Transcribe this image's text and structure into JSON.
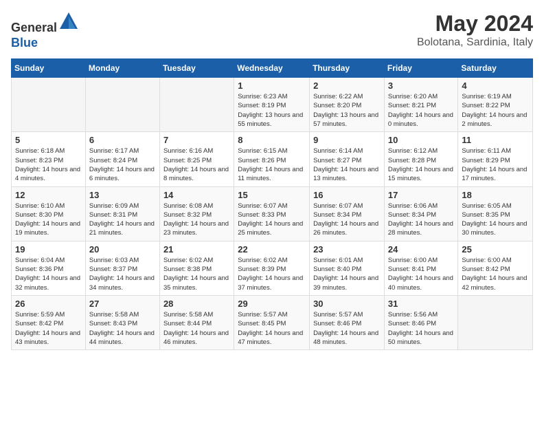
{
  "header": {
    "logo_line1": "General",
    "logo_line2": "Blue",
    "month_title": "May 2024",
    "location": "Bolotana, Sardinia, Italy"
  },
  "days_of_week": [
    "Sunday",
    "Monday",
    "Tuesday",
    "Wednesday",
    "Thursday",
    "Friday",
    "Saturday"
  ],
  "weeks": [
    [
      {
        "day": "",
        "sunrise": "",
        "sunset": "",
        "daylight": ""
      },
      {
        "day": "",
        "sunrise": "",
        "sunset": "",
        "daylight": ""
      },
      {
        "day": "",
        "sunrise": "",
        "sunset": "",
        "daylight": ""
      },
      {
        "day": "1",
        "sunrise": "Sunrise: 6:23 AM",
        "sunset": "Sunset: 8:19 PM",
        "daylight": "Daylight: 13 hours and 55 minutes."
      },
      {
        "day": "2",
        "sunrise": "Sunrise: 6:22 AM",
        "sunset": "Sunset: 8:20 PM",
        "daylight": "Daylight: 13 hours and 57 minutes."
      },
      {
        "day": "3",
        "sunrise": "Sunrise: 6:20 AM",
        "sunset": "Sunset: 8:21 PM",
        "daylight": "Daylight: 14 hours and 0 minutes."
      },
      {
        "day": "4",
        "sunrise": "Sunrise: 6:19 AM",
        "sunset": "Sunset: 8:22 PM",
        "daylight": "Daylight: 14 hours and 2 minutes."
      }
    ],
    [
      {
        "day": "5",
        "sunrise": "Sunrise: 6:18 AM",
        "sunset": "Sunset: 8:23 PM",
        "daylight": "Daylight: 14 hours and 4 minutes."
      },
      {
        "day": "6",
        "sunrise": "Sunrise: 6:17 AM",
        "sunset": "Sunset: 8:24 PM",
        "daylight": "Daylight: 14 hours and 6 minutes."
      },
      {
        "day": "7",
        "sunrise": "Sunrise: 6:16 AM",
        "sunset": "Sunset: 8:25 PM",
        "daylight": "Daylight: 14 hours and 8 minutes."
      },
      {
        "day": "8",
        "sunrise": "Sunrise: 6:15 AM",
        "sunset": "Sunset: 8:26 PM",
        "daylight": "Daylight: 14 hours and 11 minutes."
      },
      {
        "day": "9",
        "sunrise": "Sunrise: 6:14 AM",
        "sunset": "Sunset: 8:27 PM",
        "daylight": "Daylight: 14 hours and 13 minutes."
      },
      {
        "day": "10",
        "sunrise": "Sunrise: 6:12 AM",
        "sunset": "Sunset: 8:28 PM",
        "daylight": "Daylight: 14 hours and 15 minutes."
      },
      {
        "day": "11",
        "sunrise": "Sunrise: 6:11 AM",
        "sunset": "Sunset: 8:29 PM",
        "daylight": "Daylight: 14 hours and 17 minutes."
      }
    ],
    [
      {
        "day": "12",
        "sunrise": "Sunrise: 6:10 AM",
        "sunset": "Sunset: 8:30 PM",
        "daylight": "Daylight: 14 hours and 19 minutes."
      },
      {
        "day": "13",
        "sunrise": "Sunrise: 6:09 AM",
        "sunset": "Sunset: 8:31 PM",
        "daylight": "Daylight: 14 hours and 21 minutes."
      },
      {
        "day": "14",
        "sunrise": "Sunrise: 6:08 AM",
        "sunset": "Sunset: 8:32 PM",
        "daylight": "Daylight: 14 hours and 23 minutes."
      },
      {
        "day": "15",
        "sunrise": "Sunrise: 6:07 AM",
        "sunset": "Sunset: 8:33 PM",
        "daylight": "Daylight: 14 hours and 25 minutes."
      },
      {
        "day": "16",
        "sunrise": "Sunrise: 6:07 AM",
        "sunset": "Sunset: 8:34 PM",
        "daylight": "Daylight: 14 hours and 26 minutes."
      },
      {
        "day": "17",
        "sunrise": "Sunrise: 6:06 AM",
        "sunset": "Sunset: 8:34 PM",
        "daylight": "Daylight: 14 hours and 28 minutes."
      },
      {
        "day": "18",
        "sunrise": "Sunrise: 6:05 AM",
        "sunset": "Sunset: 8:35 PM",
        "daylight": "Daylight: 14 hours and 30 minutes."
      }
    ],
    [
      {
        "day": "19",
        "sunrise": "Sunrise: 6:04 AM",
        "sunset": "Sunset: 8:36 PM",
        "daylight": "Daylight: 14 hours and 32 minutes."
      },
      {
        "day": "20",
        "sunrise": "Sunrise: 6:03 AM",
        "sunset": "Sunset: 8:37 PM",
        "daylight": "Daylight: 14 hours and 34 minutes."
      },
      {
        "day": "21",
        "sunrise": "Sunrise: 6:02 AM",
        "sunset": "Sunset: 8:38 PM",
        "daylight": "Daylight: 14 hours and 35 minutes."
      },
      {
        "day": "22",
        "sunrise": "Sunrise: 6:02 AM",
        "sunset": "Sunset: 8:39 PM",
        "daylight": "Daylight: 14 hours and 37 minutes."
      },
      {
        "day": "23",
        "sunrise": "Sunrise: 6:01 AM",
        "sunset": "Sunset: 8:40 PM",
        "daylight": "Daylight: 14 hours and 39 minutes."
      },
      {
        "day": "24",
        "sunrise": "Sunrise: 6:00 AM",
        "sunset": "Sunset: 8:41 PM",
        "daylight": "Daylight: 14 hours and 40 minutes."
      },
      {
        "day": "25",
        "sunrise": "Sunrise: 6:00 AM",
        "sunset": "Sunset: 8:42 PM",
        "daylight": "Daylight: 14 hours and 42 minutes."
      }
    ],
    [
      {
        "day": "26",
        "sunrise": "Sunrise: 5:59 AM",
        "sunset": "Sunset: 8:42 PM",
        "daylight": "Daylight: 14 hours and 43 minutes."
      },
      {
        "day": "27",
        "sunrise": "Sunrise: 5:58 AM",
        "sunset": "Sunset: 8:43 PM",
        "daylight": "Daylight: 14 hours and 44 minutes."
      },
      {
        "day": "28",
        "sunrise": "Sunrise: 5:58 AM",
        "sunset": "Sunset: 8:44 PM",
        "daylight": "Daylight: 14 hours and 46 minutes."
      },
      {
        "day": "29",
        "sunrise": "Sunrise: 5:57 AM",
        "sunset": "Sunset: 8:45 PM",
        "daylight": "Daylight: 14 hours and 47 minutes."
      },
      {
        "day": "30",
        "sunrise": "Sunrise: 5:57 AM",
        "sunset": "Sunset: 8:46 PM",
        "daylight": "Daylight: 14 hours and 48 minutes."
      },
      {
        "day": "31",
        "sunrise": "Sunrise: 5:56 AM",
        "sunset": "Sunset: 8:46 PM",
        "daylight": "Daylight: 14 hours and 50 minutes."
      },
      {
        "day": "",
        "sunrise": "",
        "sunset": "",
        "daylight": ""
      }
    ]
  ]
}
